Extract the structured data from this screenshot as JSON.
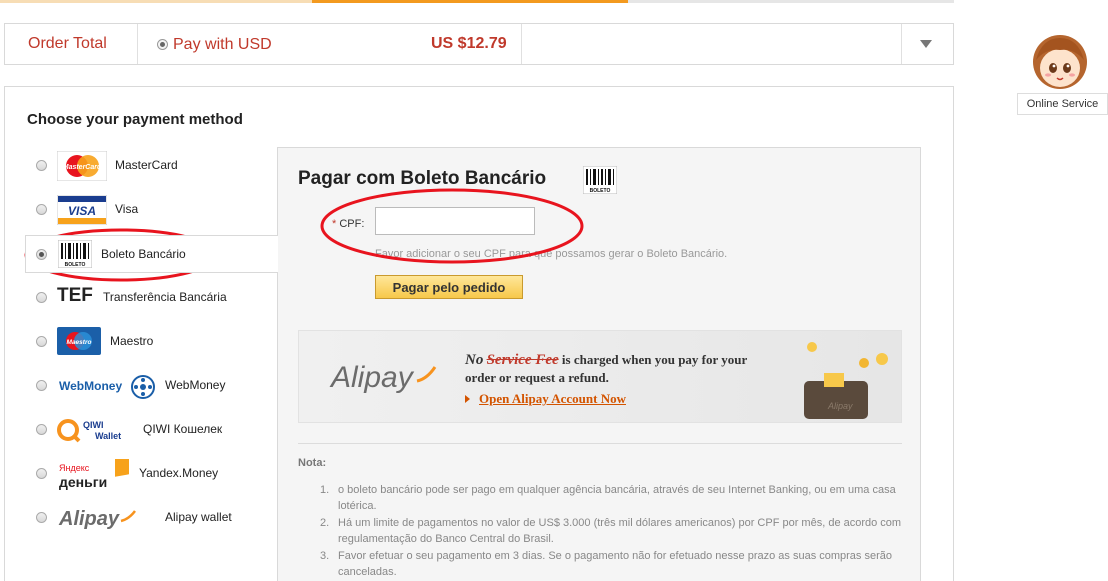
{
  "order_bar": {
    "label": "Order Total",
    "pay_option": "Pay with USD",
    "amount": "US $12.79"
  },
  "online_service": "Online Service",
  "payment": {
    "title": "Choose your payment method",
    "methods": [
      {
        "label": "MasterCard",
        "selected": false
      },
      {
        "label": "Visa",
        "selected": false
      },
      {
        "label": "Boleto Bancário",
        "selected": true
      },
      {
        "label": "Transferência Bancária",
        "logo_text": "TEF",
        "selected": false
      },
      {
        "label": "Maestro",
        "selected": false
      },
      {
        "label": "WebMoney",
        "logo_text": "WebMoney",
        "selected": false
      },
      {
        "label": "QIWI Кошелек",
        "logo_text": "QIWI Wallet",
        "selected": false
      },
      {
        "label": "Yandex.Money",
        "logo_text": "Яндекс деньги",
        "selected": false
      },
      {
        "label": "Alipay wallet",
        "logo_text": "Alipay",
        "selected": false
      }
    ]
  },
  "boleto": {
    "title": "Pagar com Boleto Bancário",
    "cpf_required": "*",
    "cpf_label": "CPF:",
    "cpf_value": "",
    "hint": "Favor adicionar o seu CPF para que possamos gerar o Boleto Bancário.",
    "button": "Pagar pelo pedido"
  },
  "alipay_banner": {
    "logo": "Alipay",
    "no": "No",
    "service_fee": "Service Fee",
    "line1_rest": "is charged when you pay for your",
    "line2": "order or request a refund.",
    "link": "Open Alipay Account Now"
  },
  "nota": {
    "title": "Nota:",
    "items": [
      "o boleto bancário pode ser pago em qualquer agência bancária, através de seu Internet Banking, ou em uma casa lotérica.",
      "Há um limite de pagamentos no valor de US$ 3.000 (três mil dólares americanos) por CPF por mês, de acordo com regulamentação do Banco Central do Brasil.",
      "Favor efetuar o seu pagamento em 3 dias. Se o pagamento não for efetuado nesse prazo as suas compras serão canceladas."
    ]
  },
  "colors": {
    "accent_red": "#c0392b",
    "progress_orange": "#f39a1f",
    "button_yellow": "#f7c84a",
    "annotation_red": "#e8141e"
  }
}
